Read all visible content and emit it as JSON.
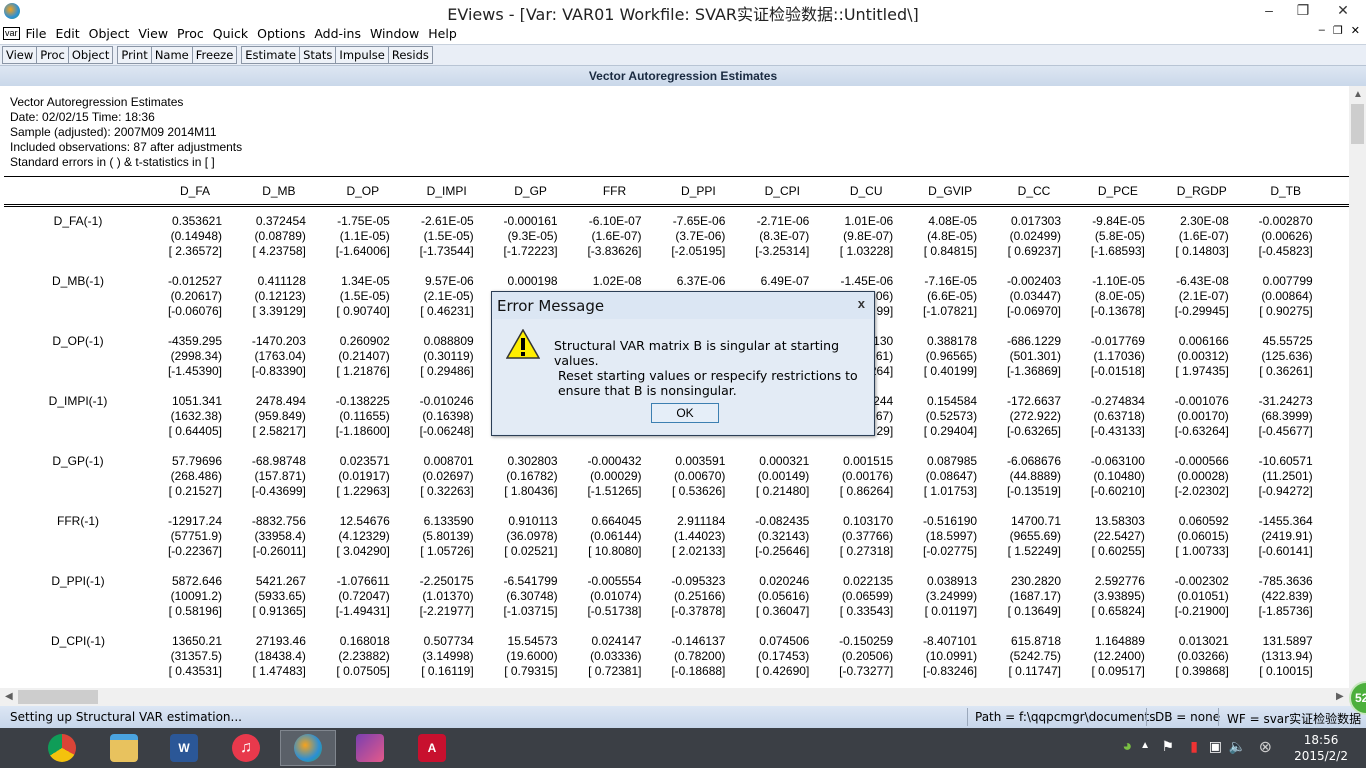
{
  "window": {
    "title": "EViews - [Var: VAR01    Workfile: SVAR实证检验数据::Untitled\\]"
  },
  "menu": [
    "File",
    "Edit",
    "Object",
    "View",
    "Proc",
    "Quick",
    "Options",
    "Add-ins",
    "Window",
    "Help"
  ],
  "menu_badge": "var",
  "toolbar": {
    "group1": [
      "View",
      "Proc",
      "Object"
    ],
    "group2": [
      "Print",
      "Name",
      "Freeze"
    ],
    "group3": [
      "Estimate",
      "Stats",
      "Impulse",
      "Resids"
    ]
  },
  "object_title": "Vector Autoregression Estimates",
  "header_lines": [
    "Vector Autoregression Estimates",
    "Date: 02/02/15   Time: 18:36",
    "Sample (adjusted): 2007M09 2014M11",
    "Included observations: 87 after adjustments",
    "Standard errors in ( ) & t-statistics in [ ]"
  ],
  "columns": [
    "D_FA",
    "D_MB",
    "D_OP",
    "D_IMPI",
    "D_GP",
    "FFR",
    "D_PPI",
    "D_CPI",
    "D_CU",
    "D_GVIP",
    "D_CC",
    "D_PCE",
    "D_RGDP",
    "D_TB"
  ],
  "rows": [
    {
      "label": "D_FA(-1)",
      "coef": [
        "0.353621",
        "0.372454",
        "-1.75E-05",
        "-2.61E-05",
        "-0.000161",
        "-6.10E-07",
        "-7.65E-06",
        "-2.71E-06",
        "1.01E-06",
        "4.08E-05",
        "0.017303",
        "-9.84E-05",
        "2.30E-08",
        "-0.002870"
      ],
      "se": [
        "(0.14948)",
        "(0.08789)",
        "(1.1E-05)",
        "(1.5E-05)",
        "(9.3E-05)",
        "(1.6E-07)",
        "(3.7E-06)",
        "(8.3E-07)",
        "(9.8E-07)",
        "(4.8E-05)",
        "(0.02499)",
        "(5.8E-05)",
        "(1.6E-07)",
        "(0.00626)"
      ],
      "t": [
        "[ 2.36572]",
        "[ 4.23758]",
        "[-1.64006]",
        "[-1.73544]",
        "[-1.72223]",
        "[-3.83626]",
        "[-2.05195]",
        "[-3.25314]",
        "[ 1.03228]",
        "[ 0.84815]",
        "[ 0.69237]",
        "[-1.68593]",
        "[ 0.14803]",
        "[-0.45823]"
      ]
    },
    {
      "label": "D_MB(-1)",
      "coef": [
        "-0.012527",
        "0.411128",
        "1.34E-05",
        "9.57E-06",
        "0.000198",
        "1.02E-08",
        "6.37E-06",
        "6.49E-07",
        "-1.45E-06",
        "-7.16E-05",
        "-0.002403",
        "-1.10E-05",
        "-6.43E-08",
        "0.007799"
      ],
      "se": [
        "(0.20617)",
        "(0.12123)",
        "(1.5E-05)",
        "(2.1E-05)",
        "",
        "",
        "",
        "",
        "06)",
        "(6.6E-05)",
        "(0.03447)",
        "(8.0E-05)",
        "(2.1E-07)",
        "(0.00864)"
      ],
      "t": [
        "[-0.06076]",
        "[ 3.39129]",
        "[ 0.90740]",
        "[ 0.46231]",
        "",
        "",
        "",
        "",
        "99]",
        "[-1.07821]",
        "[-0.06970]",
        "[-0.13678]",
        "[-0.29945]",
        "[ 0.90275]"
      ]
    },
    {
      "label": "D_OP(-1)",
      "coef": [
        "-4359.295",
        "-1470.203",
        "0.260902",
        "0.088809",
        "",
        "",
        "",
        "",
        "130",
        "0.388178",
        "-686.1229",
        "-0.017769",
        "0.006166",
        "45.55725"
      ],
      "se": [
        "(2998.34)",
        "(1763.04)",
        "(0.21407)",
        "(0.30119)",
        "",
        "",
        "",
        "",
        "61)",
        "(0.96565)",
        "(501.301)",
        "(1.17036)",
        "(0.00312)",
        "(125.636)"
      ],
      "t": [
        "[-1.45390]",
        "[-0.83390]",
        "[ 1.21876]",
        "[ 0.29486]",
        "",
        "",
        "",
        "",
        "264]",
        "[ 0.40199]",
        "[-1.36869]",
        "[-0.01518]",
        "[ 1.97435]",
        "[ 0.36261]"
      ]
    },
    {
      "label": "D_IMPI(-1)",
      "coef": [
        "1051.341",
        "2478.494",
        "-0.138225",
        "-0.010246",
        "",
        "",
        "",
        "",
        "244",
        "0.154584",
        "-172.6637",
        "-0.274834",
        "-0.001076",
        "-31.24273"
      ],
      "se": [
        "(1632.38)",
        "(959.849)",
        "(0.11655)",
        "(0.16398)",
        "",
        "",
        "",
        "",
        "67)",
        "(0.52573)",
        "(272.922)",
        "(0.63718)",
        "(0.00170)",
        "(68.3999)"
      ],
      "t": [
        "[ 0.64405]",
        "[ 2.58217]",
        "[-1.18600]",
        "[-0.06248]",
        "",
        "",
        "",
        "",
        "29]",
        "[ 0.29404]",
        "[-0.63265]",
        "[-0.43133]",
        "[-0.63264]",
        "[-0.45677]"
      ]
    },
    {
      "label": "D_GP(-1)",
      "coef": [
        "57.79696",
        "-68.98748",
        "0.023571",
        "0.008701",
        "0.302803",
        "-0.000432",
        "0.003591",
        "0.000321",
        "0.001515",
        "0.087985",
        "-6.068676",
        "-0.063100",
        "-0.000566",
        "-10.60571"
      ],
      "se": [
        "(268.486)",
        "(157.871)",
        "(0.01917)",
        "(0.02697)",
        "(0.16782)",
        "(0.00029)",
        "(0.00670)",
        "(0.00149)",
        "(0.00176)",
        "(0.08647)",
        "(44.8889)",
        "(0.10480)",
        "(0.00028)",
        "(11.2501)"
      ],
      "t": [
        "[ 0.21527]",
        "[-0.43699]",
        "[ 1.22963]",
        "[ 0.32263]",
        "[ 1.80436]",
        "[-1.51265]",
        "[ 0.53626]",
        "[ 0.21480]",
        "[ 0.86264]",
        "[ 1.01753]",
        "[-0.13519]",
        "[-0.60210]",
        "[-2.02302]",
        "[-0.94272]"
      ]
    },
    {
      "label": "FFR(-1)",
      "coef": [
        "-12917.24",
        "-8832.756",
        "12.54676",
        "6.133590",
        "0.910113",
        "0.664045",
        "2.911184",
        "-0.082435",
        "0.103170",
        "-0.516190",
        "14700.71",
        "13.58303",
        "0.060592",
        "-1455.364"
      ],
      "se": [
        "(57751.9)",
        "(33958.4)",
        "(4.12329)",
        "(5.80139)",
        "(36.0978)",
        "(0.06144)",
        "(1.44023)",
        "(0.32143)",
        "(0.37766)",
        "(18.5997)",
        "(9655.69)",
        "(22.5427)",
        "(0.06015)",
        "(2419.91)"
      ],
      "t": [
        "[-0.22367]",
        "[-0.26011]",
        "[ 3.04290]",
        "[ 1.05726]",
        "[ 0.02521]",
        "[ 10.8080]",
        "[ 2.02133]",
        "[-0.25646]",
        "[ 0.27318]",
        "[-0.02775]",
        "[ 1.52249]",
        "[ 0.60255]",
        "[ 1.00733]",
        "[-0.60141]"
      ]
    },
    {
      "label": "D_PPI(-1)",
      "coef": [
        "5872.646",
        "5421.267",
        "-1.076611",
        "-2.250175",
        "-6.541799",
        "-0.005554",
        "-0.095323",
        "0.020246",
        "0.022135",
        "0.038913",
        "230.2820",
        "2.592776",
        "-0.002302",
        "-785.3636"
      ],
      "se": [
        "(10091.2)",
        "(5933.65)",
        "(0.72047)",
        "(1.01370)",
        "(6.30748)",
        "(0.01074)",
        "(0.25166)",
        "(0.05616)",
        "(0.06599)",
        "(3.24999)",
        "(1687.17)",
        "(3.93895)",
        "(0.01051)",
        "(422.839)"
      ],
      "t": [
        "[ 0.58196]",
        "[ 0.91365]",
        "[-1.49431]",
        "[-2.21977]",
        "[-1.03715]",
        "[-0.51738]",
        "[-0.37878]",
        "[ 0.36047]",
        "[ 0.33543]",
        "[ 0.01197]",
        "[ 0.13649]",
        "[ 0.65824]",
        "[-0.21900]",
        "[-1.85736]"
      ]
    },
    {
      "label": "D_CPI(-1)",
      "coef": [
        "13650.21",
        "27193.46",
        "0.168018",
        "0.507734",
        "15.54573",
        "0.024147",
        "-0.146137",
        "0.074506",
        "-0.150259",
        "-8.407101",
        "615.8718",
        "1.164889",
        "0.013021",
        "131.5897"
      ],
      "se": [
        "(31357.5)",
        "(18438.4)",
        "(2.23882)",
        "(3.14998)",
        "(19.6000)",
        "(0.03336)",
        "(0.78200)",
        "(0.17453)",
        "(0.20506)",
        "(10.0991)",
        "(5242.75)",
        "(12.2400)",
        "(0.03266)",
        "(1313.94)"
      ],
      "t": [
        "[ 0.43531]",
        "[ 1.47483]",
        "[ 0.07505]",
        "[ 0.16119]",
        "[ 0.79315]",
        "[ 0.72381]",
        "[-0.18688]",
        "[ 0.42690]",
        "[-0.73277]",
        "[-0.83246]",
        "[ 0.11747]",
        "[ 0.09517]",
        "[ 0.39868]",
        "[ 0.10015]"
      ]
    }
  ],
  "dialog": {
    "title": "Error Message",
    "close": "x",
    "lines": [
      "Structural VAR matrix B is singular at starting values.",
      " Reset starting values or respecify restrictions to",
      " ensure that B is nonsingular."
    ],
    "ok": "OK"
  },
  "status": {
    "message": "Setting up Structural VAR estimation...",
    "path": "Path = f:\\qqpcmgr\\documents",
    "db": "DB = none",
    "wf": "WF = svar实证检验数据"
  },
  "taskbar": {
    "apps": [
      "chrome",
      "file-explorer",
      "word",
      "itunes",
      "eviews",
      "ebook-reader",
      "acrobat"
    ],
    "time": "18:56",
    "date": "2015/2/2"
  },
  "bubble": "52"
}
